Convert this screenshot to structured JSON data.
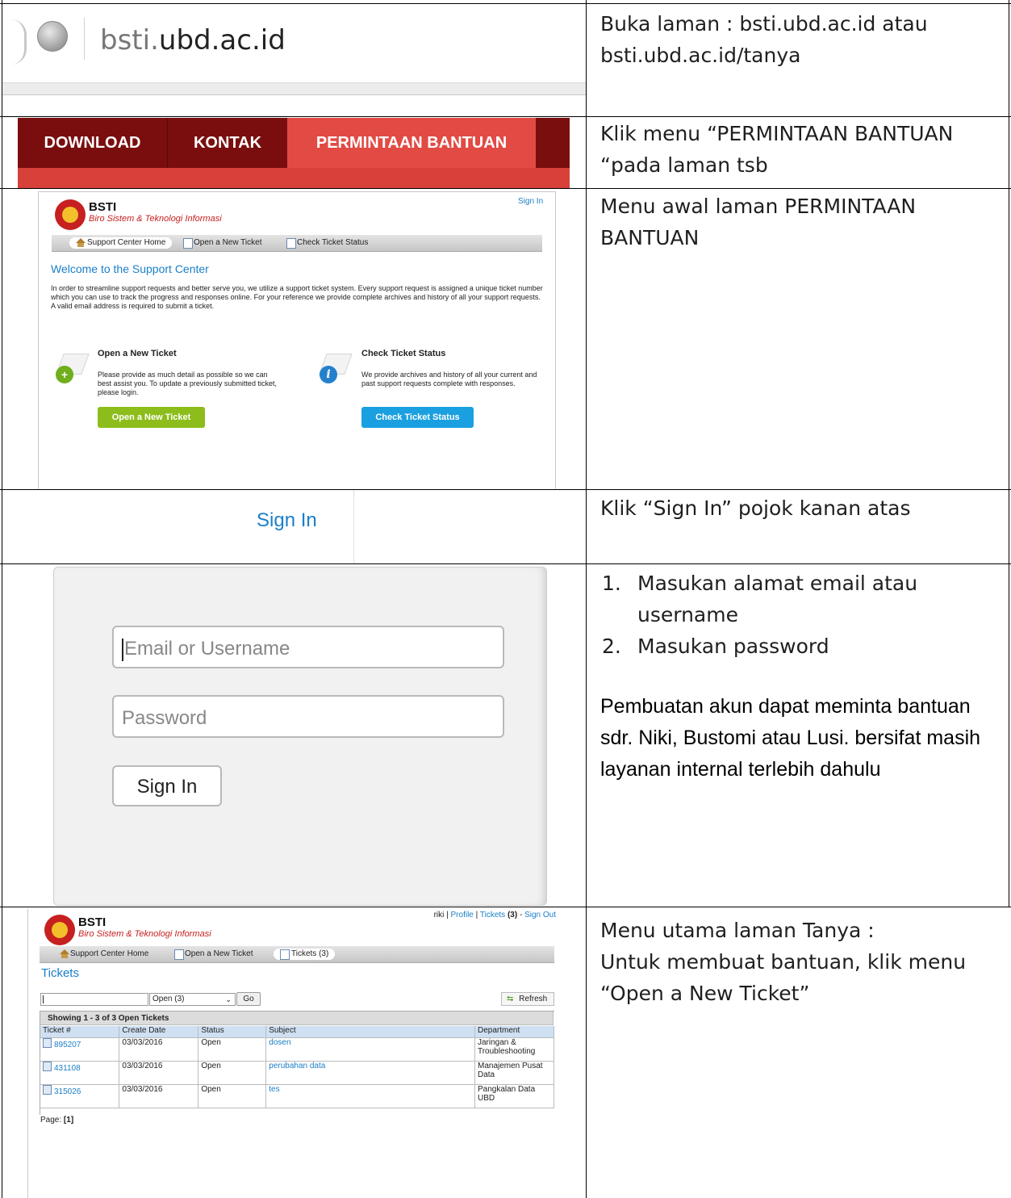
{
  "rows": [
    {
      "instruction": "Buka laman : bsti.ubd.ac.id atau bsti.ubd.ac.id/tanya"
    },
    {
      "instruction": "Klik menu “PERMINTAAN BANTUAN “pada laman tsb"
    },
    {
      "instruction": "Menu awal laman PERMINTAAN BANTUAN"
    },
    {
      "instruction": "Klik “Sign In” pojok kanan atas"
    },
    {
      "steps": [
        "Masukan alamat email atau username",
        "Masukan password"
      ],
      "note": "Pembuatan akun dapat meminta bantuan sdr. Niki, Bustomi atau Lusi. bersifat masih layanan internal terlebih dahulu"
    },
    {
      "instruction_line1": "Menu utama laman Tanya :",
      "instruction_line2": "Untuk membuat bantuan, klik menu “Open a New Ticket”"
    }
  ],
  "browser": {
    "url_prefix": "bsti.",
    "url_domain": "ubd.ac.id",
    "globe_icon": "globe-icon"
  },
  "site_nav": {
    "items": [
      "DOWNLOAD",
      "KONTAK",
      "PERMINTAAN BANTUAN"
    ]
  },
  "support_home": {
    "brand": "BSTI",
    "brand_sub": "Biro Sistem & Teknologi Informasi",
    "sign_in": "Sign In",
    "nav": [
      "Support Center Home",
      "Open a New Ticket",
      "Check Ticket Status"
    ],
    "welcome": "Welcome to the Support Center",
    "intro": "In order to streamline support requests and better serve you, we utilize a support ticket system. Every support request is assigned a unique ticket number which you can use to track the progress and responses online. For your reference we provide complete archives and history of all your support requests. A valid email address is required to submit a ticket.",
    "open_title": "Open a New Ticket",
    "open_text": "Please provide as much detail as possible so we can best assist you. To update a previously submitted ticket, please login.",
    "open_button": "Open a New Ticket",
    "check_title": "Check Ticket Status",
    "check_text": "We provide archives and history of all your current and past support requests complete with responses.",
    "check_button": "Check Ticket Status"
  },
  "signin_crop": {
    "label": "Sign In"
  },
  "login": {
    "email_placeholder": "Email or Username",
    "password_placeholder": "Password",
    "button": "Sign In"
  },
  "tickets_page": {
    "brand": "BSTI",
    "brand_sub": "Biro Sistem & Teknologi Informasi",
    "user": "riki",
    "profile": "Profile",
    "tickets_link": "Tickets",
    "tickets_count": "(3)",
    "sign_out": "Sign Out",
    "nav": [
      "Support Center Home",
      "Open a New Ticket",
      "Tickets (3)"
    ],
    "title": "Tickets",
    "filter_value": "Open (3)",
    "go": "Go",
    "refresh": "Refresh",
    "showing": "Showing  1 - 3 of 3 Open Tickets",
    "columns": [
      "Ticket #",
      "Create Date",
      "Status",
      "Subject",
      "Department"
    ],
    "rows": [
      [
        "895207",
        "03/03/2016",
        "Open",
        "dosen",
        "Jaringan & Troubleshooting"
      ],
      [
        "431108",
        "03/03/2016",
        "Open",
        "perubahan data",
        "Manajemen Pusat Data"
      ],
      [
        "315026",
        "03/03/2016",
        "Open",
        "tes",
        "Pangkalan Data UBD"
      ]
    ],
    "page_label": "Page:",
    "page_value": "[1]"
  }
}
